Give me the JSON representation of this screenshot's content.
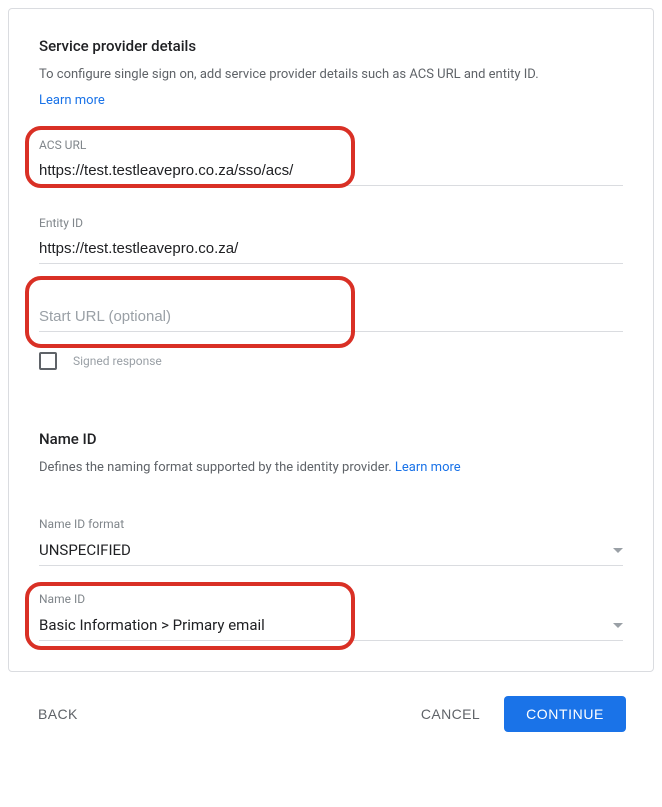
{
  "service_provider": {
    "title": "Service provider details",
    "description": "To configure single sign on, add service provider details such as ACS URL and entity ID.",
    "learn_more": "Learn more",
    "acs_url_label": "ACS URL",
    "acs_url_value": "https://test.testleavepro.co.za/sso/acs/",
    "entity_id_label": "Entity ID",
    "entity_id_value": "https://test.testleavepro.co.za/",
    "start_url_placeholder": "Start URL (optional)",
    "start_url_value": "",
    "signed_response_label": "Signed response"
  },
  "name_id": {
    "title": "Name ID",
    "description": "Defines the naming format supported by the identity provider. ",
    "learn_more": "Learn more",
    "format_label": "Name ID format",
    "format_value": "UNSPECIFIED",
    "id_label": "Name ID",
    "id_value": "Basic Information > Primary email"
  },
  "footer": {
    "back": "BACK",
    "cancel": "CANCEL",
    "continue": "CONTINUE"
  }
}
